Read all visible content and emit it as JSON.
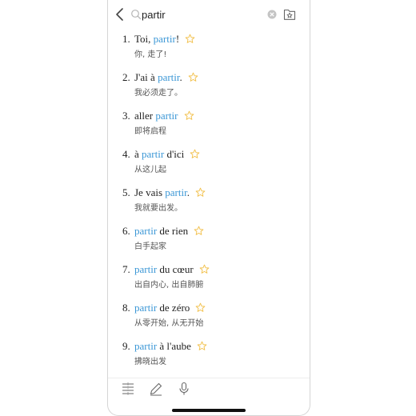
{
  "search": {
    "query": "partir"
  },
  "results": [
    {
      "number": "1.",
      "parts": [
        {
          "t": "Toi, ",
          "hl": false
        },
        {
          "t": "partir",
          "hl": true
        },
        {
          "t": "!",
          "hl": false
        }
      ],
      "translation": "你, 走了!"
    },
    {
      "number": "2.",
      "parts": [
        {
          "t": "J'ai à ",
          "hl": false
        },
        {
          "t": "partir",
          "hl": true
        },
        {
          "t": ".",
          "hl": false
        }
      ],
      "translation": "我必须走了。"
    },
    {
      "number": "3.",
      "parts": [
        {
          "t": "aller ",
          "hl": false
        },
        {
          "t": "partir",
          "hl": true
        }
      ],
      "translation": "即将启程"
    },
    {
      "number": "4.",
      "parts": [
        {
          "t": "à ",
          "hl": false
        },
        {
          "t": "partir",
          "hl": true
        },
        {
          "t": " d'ici",
          "hl": false
        }
      ],
      "translation": "从这儿起"
    },
    {
      "number": "5.",
      "parts": [
        {
          "t": "Je vais ",
          "hl": false
        },
        {
          "t": "partir",
          "hl": true
        },
        {
          "t": ".",
          "hl": false
        }
      ],
      "translation": "我就要出发。"
    },
    {
      "number": "6.",
      "parts": [
        {
          "t": "partir",
          "hl": true
        },
        {
          "t": " de rien",
          "hl": false
        }
      ],
      "translation": "白手起家"
    },
    {
      "number": "7.",
      "parts": [
        {
          "t": "partir",
          "hl": true
        },
        {
          "t": " du cœur",
          "hl": false
        }
      ],
      "translation": "出自内心, 出自肺腑"
    },
    {
      "number": "8.",
      "parts": [
        {
          "t": "partir",
          "hl": true
        },
        {
          "t": " de zéro",
          "hl": false
        }
      ],
      "translation": "从零开始, 从无开始"
    },
    {
      "number": "9.",
      "parts": [
        {
          "t": "partir",
          "hl": true
        },
        {
          "t": " à l'aube",
          "hl": false
        }
      ],
      "translation": "拂晓出发"
    }
  ],
  "colors": {
    "highlight": "#3b97d6",
    "star": "#f2c14e",
    "text": "#1f1f1f",
    "translation": "#555555"
  },
  "icons": {
    "back": "chevron-left-icon",
    "search": "search-icon",
    "clear": "clear-icon",
    "favorites": "favorites-folder-icon",
    "star": "star-outline-icon",
    "toolbar": [
      "list-icon",
      "pencil-icon",
      "microphone-icon"
    ]
  }
}
